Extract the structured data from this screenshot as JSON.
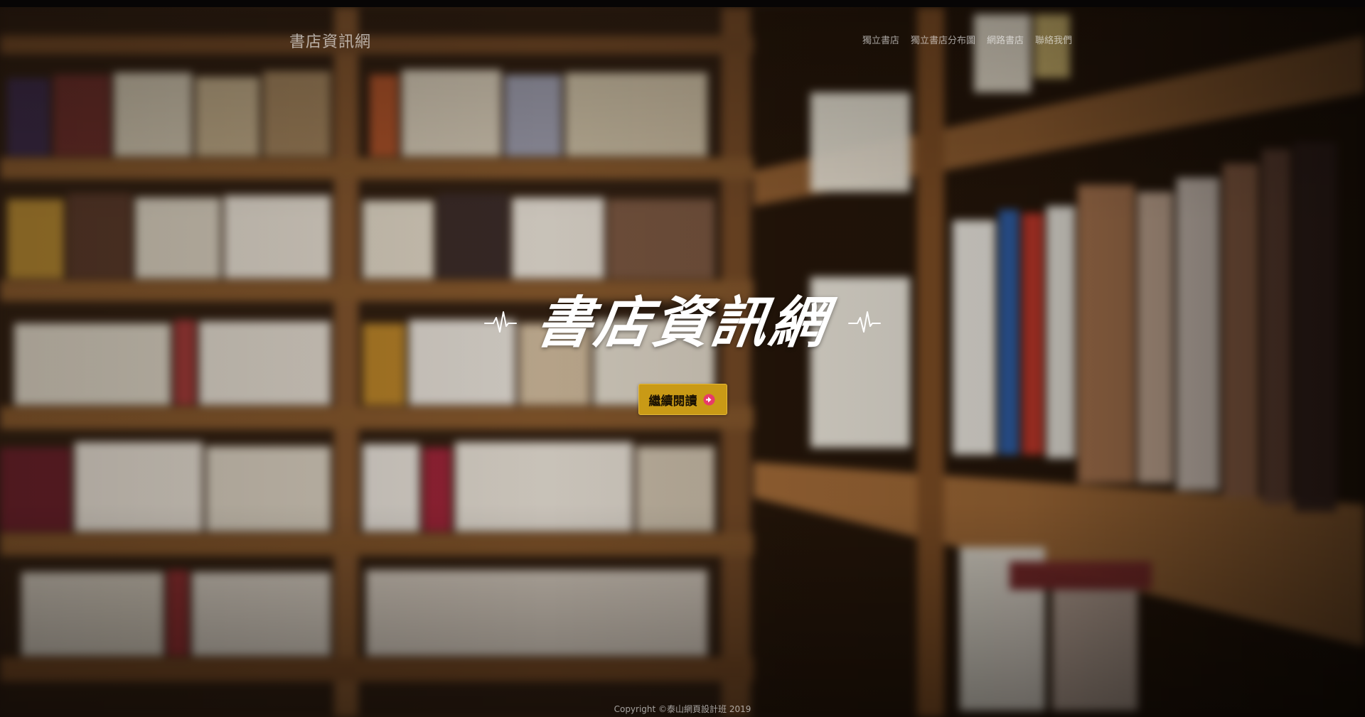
{
  "navbar": {
    "brand": "書店資訊網",
    "links": [
      {
        "label": "獨立書店"
      },
      {
        "label": "獨立書店分布圖"
      },
      {
        "label": "網路書店"
      },
      {
        "label": "聯絡我們"
      }
    ]
  },
  "hero": {
    "title": "書店資訊網",
    "cta_label": "繼續閱讀",
    "left_icon": "heartbeat-pulse-icon",
    "right_icon": "heartbeat-pulse-icon",
    "cta_icon": "arrow-circle-right-icon"
  },
  "footer": {
    "copyright": "Copyright ©泰山網頁設計班 2019"
  },
  "colors": {
    "cta_background": "#c99a16",
    "cta_border": "#e6b938",
    "cta_icon_circle": "#e83a6a",
    "title_text": "#ffffff"
  }
}
